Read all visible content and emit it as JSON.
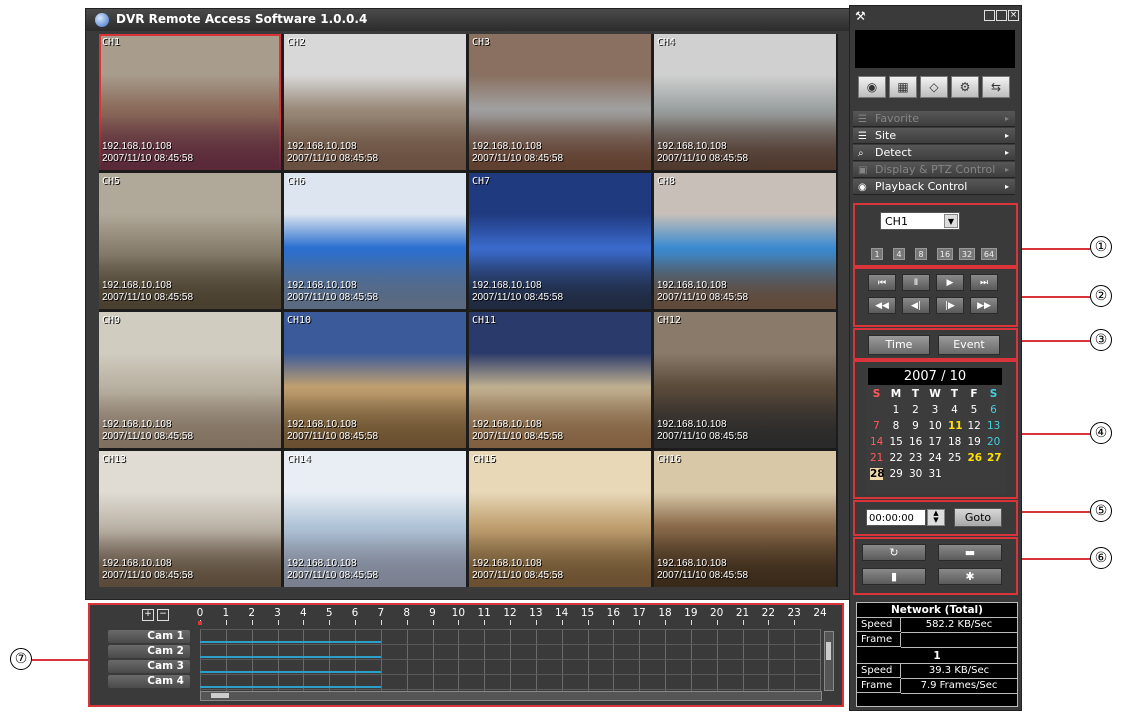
{
  "window": {
    "title": "DVR Remote Access Software  1.0.0.4"
  },
  "cameras": [
    {
      "ch": "CH1",
      "ip": "192.168.10.108",
      "ts": "2007/11/10 08:45:58",
      "colors": [
        "#a89c8c",
        "#8a6a5a",
        "#5a2a3a"
      ]
    },
    {
      "ch": "CH2",
      "ip": "192.168.10.108",
      "ts": "2007/11/10 08:45:58",
      "colors": [
        "#d8d8d8",
        "#9a8a7a",
        "#6a5040"
      ]
    },
    {
      "ch": "CH3",
      "ip": "192.168.10.108",
      "ts": "2007/11/10 08:45:58",
      "colors": [
        "#8a7060",
        "#a0a0a0",
        "#604030"
      ]
    },
    {
      "ch": "CH4",
      "ip": "192.168.10.108",
      "ts": "2007/11/10 08:45:58",
      "colors": [
        "#d0d0d0",
        "#9aa0a0",
        "#503a30"
      ]
    },
    {
      "ch": "CH5",
      "ip": "192.168.10.108",
      "ts": "2007/11/10 08:45:58",
      "colors": [
        "#b0a898",
        "#8a8070",
        "#4a4030"
      ]
    },
    {
      "ch": "CH6",
      "ip": "192.168.10.108",
      "ts": "2007/11/10 08:45:58",
      "colors": [
        "#dde6f0",
        "#2b6fd0",
        "#5a6a80"
      ]
    },
    {
      "ch": "CH7",
      "ip": "192.168.10.108",
      "ts": "2007/11/10 08:45:58",
      "colors": [
        "#203a80",
        "#3a6acc",
        "#202a40"
      ]
    },
    {
      "ch": "CH8",
      "ip": "192.168.10.108",
      "ts": "2007/11/10 08:45:58",
      "colors": [
        "#c8c0b8",
        "#3a8ad0",
        "#604a3a"
      ]
    },
    {
      "ch": "CH9",
      "ip": "192.168.10.108",
      "ts": "2007/11/10 08:45:58",
      "colors": [
        "#d0ccc0",
        "#b8b0a0",
        "#807060"
      ]
    },
    {
      "ch": "CH10",
      "ip": "192.168.10.108",
      "ts": "2007/11/10 08:45:58",
      "colors": [
        "#3a5a9a",
        "#c0a070",
        "#6a5030"
      ]
    },
    {
      "ch": "CH11",
      "ip": "192.168.10.108",
      "ts": "2007/11/10 08:45:58",
      "colors": [
        "#2a3a6a",
        "#c0b090",
        "#806040"
      ]
    },
    {
      "ch": "CH12",
      "ip": "192.168.10.108",
      "ts": "2007/11/10 08:45:58",
      "colors": [
        "#8a7a6a",
        "#5a4a3a",
        "#2a2a2a"
      ]
    },
    {
      "ch": "CH13",
      "ip": "192.168.10.108",
      "ts": "2007/11/10 08:45:58",
      "colors": [
        "#e0dcd4",
        "#bcb4a8",
        "#5a4a3a"
      ]
    },
    {
      "ch": "CH14",
      "ip": "192.168.10.108",
      "ts": "2007/11/10 08:45:58",
      "colors": [
        "#e8eef4",
        "#b0c4d8",
        "#7a8090"
      ]
    },
    {
      "ch": "CH15",
      "ip": "192.168.10.108",
      "ts": "2007/11/10 08:45:58",
      "colors": [
        "#e8d8b8",
        "#c0a070",
        "#6a5030"
      ]
    },
    {
      "ch": "CH16",
      "ip": "192.168.10.108",
      "ts": "2007/11/10 08:45:58",
      "colors": [
        "#d8c8a8",
        "#8a6a4a",
        "#3a2a1a"
      ]
    }
  ],
  "panel": {
    "top_icon": "tools-icon",
    "win_controls": [
      "minimize-icon",
      "maximize-icon",
      "close-icon"
    ],
    "sub_buttons": [
      "camera-view-icon",
      "grid-layout-icon",
      "eraser-icon",
      "settings-gear-icon",
      "network-swap-icon"
    ],
    "menu": [
      {
        "label": "Favorite",
        "enabled": false,
        "icon": "list-icon"
      },
      {
        "label": "Site",
        "enabled": true,
        "icon": "list-icon"
      },
      {
        "label": "Detect",
        "enabled": true,
        "icon": "search-icon"
      },
      {
        "label": "Display & PTZ Control",
        "enabled": false,
        "icon": "display-icon"
      },
      {
        "label": "Playback Control",
        "enabled": true,
        "icon": "play-circle-icon"
      }
    ],
    "channel_select": "CH1",
    "channel_buttons": [
      "1",
      "4",
      "8",
      "16",
      "32",
      "64"
    ],
    "playback_row1": [
      "skip-back-icon",
      "pause-icon",
      "play-icon",
      "skip-forward-icon"
    ],
    "playback_row2": [
      "rewind-icon",
      "step-back-icon",
      "step-forward-icon",
      "fast-forward-icon"
    ],
    "mode_buttons": [
      "Time",
      "Event"
    ],
    "calendar": {
      "year": "2007",
      "separator": "/",
      "month": "10",
      "weekdays": [
        "S",
        "M",
        "T",
        "W",
        "T",
        "F",
        "S"
      ],
      "weeks": [
        [
          "",
          "1",
          "2",
          "3",
          "4",
          "5",
          "6"
        ],
        [
          "7",
          "8",
          "9",
          "10",
          "11",
          "12",
          "13"
        ],
        [
          "14",
          "15",
          "16",
          "17",
          "18",
          "19",
          "20"
        ],
        [
          "21",
          "22",
          "23",
          "24",
          "25",
          "26",
          "27"
        ],
        [
          "28",
          "29",
          "30",
          "31",
          "",
          "",
          ""
        ]
      ],
      "highlighted": [
        "11",
        "26",
        "27"
      ],
      "selected": "28"
    },
    "time_value": "00:00:00",
    "goto_label": "Goto",
    "action_buttons": [
      "refresh-icon",
      "save-icon",
      "export-icon",
      "settings-icon"
    ],
    "network": {
      "title": "Network (Total)",
      "speed_label": "Speed",
      "speed_total": "582.2 KB/Sec",
      "frame_label": "Frame",
      "frame_total": "",
      "channel": "1",
      "speed_ch": "39.3 KB/Sec",
      "frame_ch": "7.9 Frames/Sec"
    }
  },
  "timeline": {
    "plus": "+",
    "minus": "−",
    "hours": [
      "0",
      "1",
      "2",
      "3",
      "4",
      "5",
      "6",
      "7",
      "8",
      "9",
      "10",
      "11",
      "12",
      "13",
      "14",
      "15",
      "16",
      "17",
      "18",
      "19",
      "20",
      "21",
      "22",
      "23",
      "24"
    ],
    "cams": [
      "Cam 1",
      "Cam 2",
      "Cam 3",
      "Cam 4"
    ],
    "recording_until_hour": 7
  },
  "callouts": [
    "①",
    "②",
    "③",
    "④",
    "⑤",
    "⑥",
    "⑦"
  ],
  "colors": {
    "highlight_red": "#d8343a",
    "record_bar": "#2aa0c8",
    "cal_red": "#ff5a5a",
    "cal_cyan": "#40d0e0",
    "cal_yellow": "#ffe000"
  }
}
